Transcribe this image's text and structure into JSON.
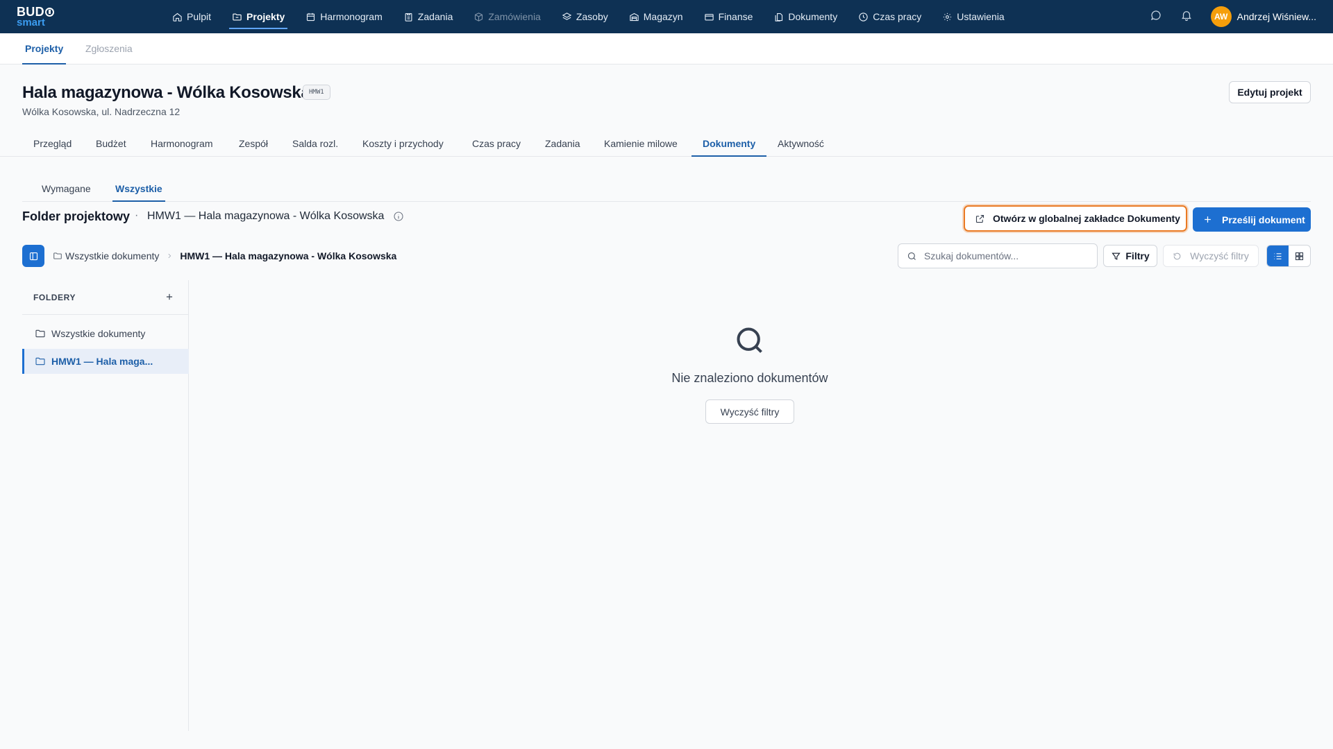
{
  "app": {
    "logo_top": "BUD",
    "logo_bottom": "smart"
  },
  "topnav": {
    "items": [
      {
        "label": "Pulpit",
        "icon": "home-icon"
      },
      {
        "label": "Projekty",
        "icon": "folder-icon",
        "active": true
      },
      {
        "label": "Harmonogram",
        "icon": "calendar-icon"
      },
      {
        "label": "Zadania",
        "icon": "clipboard-icon"
      },
      {
        "label": "Zamówienia",
        "icon": "box-icon",
        "disabled": true
      },
      {
        "label": "Zasoby",
        "icon": "layers-icon"
      },
      {
        "label": "Magazyn",
        "icon": "warehouse-icon"
      },
      {
        "label": "Finanse",
        "icon": "wallet-icon"
      },
      {
        "label": "Dokumenty",
        "icon": "document-icon"
      },
      {
        "label": "Czas pracy",
        "icon": "clock-icon"
      },
      {
        "label": "Ustawienia",
        "icon": "gear-icon"
      }
    ],
    "user_initials": "AW",
    "user_name": "Andrzej Wiśniew...",
    "avatar_color": "#f59e0b"
  },
  "subnav": {
    "items": [
      "Projekty",
      "Zgłoszenia"
    ]
  },
  "project": {
    "title": "Hala magazynowa - Wólka Kosowska",
    "code": "HMW1",
    "address": "Wólka Kosowska, ul. Nadrzeczna 12",
    "edit_label": "Edytuj projekt",
    "tabs": [
      "Przegląd",
      "Budżet",
      "Harmonogram",
      "Zespół",
      "Salda rozl.",
      "Koszty i przychody",
      "Czas pracy",
      "Zadania",
      "Kamienie milowe",
      "Dokumenty",
      "Aktywność"
    ],
    "active_tab": "Dokumenty"
  },
  "documents": {
    "subtabs": [
      "Wymagane",
      "Wszystkie"
    ],
    "active_subtab": "Wszystkie",
    "heading": "Folder projektowy",
    "separator": "·",
    "folder_name": "HMW1 — Hala magazynowa - Wólka Kosowska",
    "open_global_label": "Otwórz w globalnej zakładce Dokumenty",
    "upload_label": "Prześlij dokument",
    "breadcrumb": {
      "root": "Wszystkie dokumenty",
      "current": "HMW1 — Hala magazynowa - Wólka Kosowska"
    },
    "search_placeholder": "Szukaj dokumentów...",
    "filters_label": "Filtry",
    "clear_filters_label": "Wyczyść filtry",
    "view_mode": "list",
    "folders": {
      "title": "FOLDERY",
      "items": [
        {
          "label": "Wszystkie dokumenty",
          "active": false
        },
        {
          "label": "HMW1 — Hala maga...",
          "active": true
        }
      ]
    },
    "empty": {
      "message": "Nie znaleziono dokumentów",
      "clear_label": "Wyczyść filtry"
    }
  },
  "colors": {
    "nav_bg": "#0e3154",
    "primary": "#1d6fd1",
    "active_text": "#1d5fa8",
    "highlight_border": "#ea7a24"
  }
}
